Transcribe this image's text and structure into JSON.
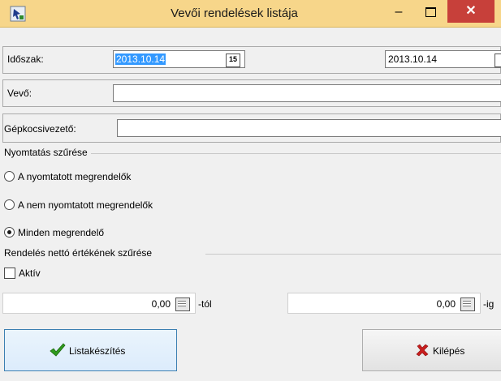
{
  "window": {
    "title": "Vevői rendelések listája",
    "minimize": "–",
    "close": "✕"
  },
  "period": {
    "label": "Időszak:",
    "from": "2013.10.14",
    "to": "2013.10.14",
    "cal_glyph": "15"
  },
  "customer": {
    "label": "Vevő:",
    "value": ""
  },
  "driver": {
    "label": "Gépkocsivezető:",
    "value": ""
  },
  "print_filter": {
    "title": "Nyomtatás szűrése",
    "options": [
      {
        "label": "A nyomtatott megrendelők",
        "selected": false
      },
      {
        "label": "A nem nyomtatott megrendelők",
        "selected": false
      },
      {
        "label": "Minden megrendelő",
        "selected": true
      }
    ]
  },
  "net_filter": {
    "title": "Rendelés nettó értékének szűrése",
    "active_label": "Aktív",
    "active": false,
    "from_value": "0,00",
    "from_suffix": "-tól",
    "to_value": "0,00",
    "to_suffix": "-ig"
  },
  "buttons": {
    "run": "Listakészítés",
    "exit": "Kilépés"
  },
  "colors": {
    "titlebar": "#f7d68a",
    "close": "#c7403a",
    "selection": "#3399ff"
  }
}
